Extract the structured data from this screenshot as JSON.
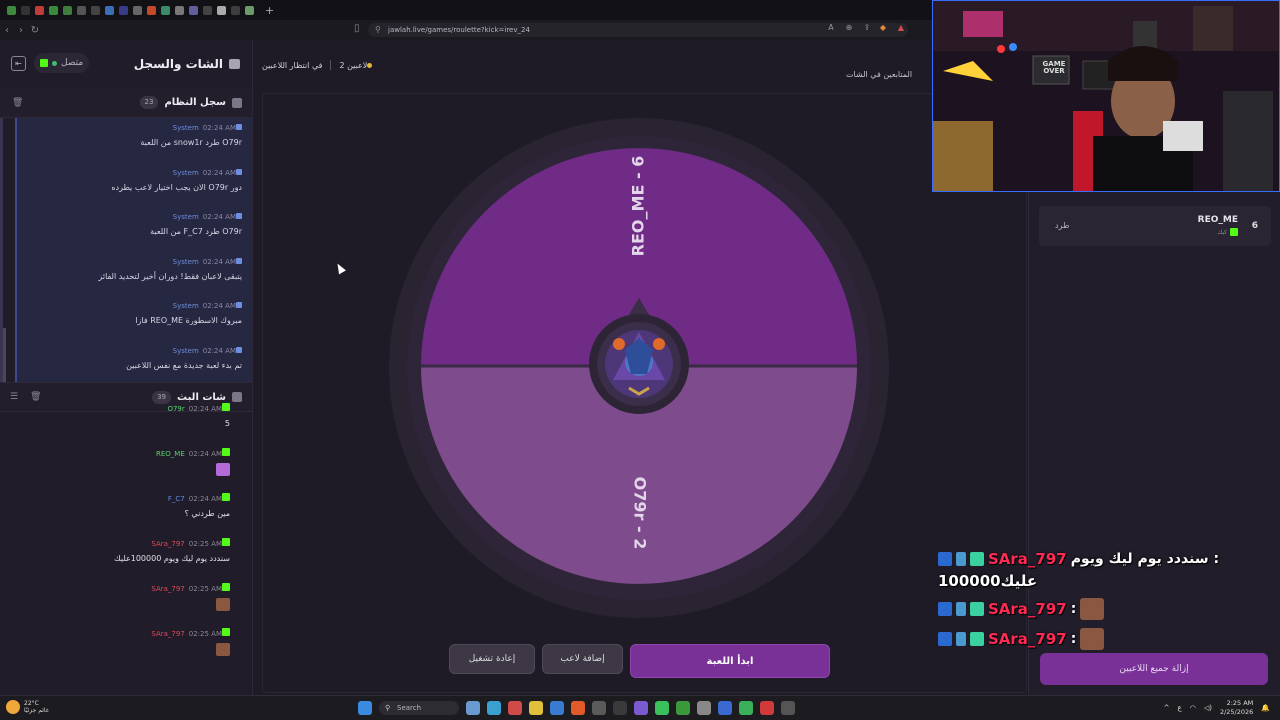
{
  "browser": {
    "url": "jawlah.live/games/roulette?kick=irev_24",
    "tab_colors": [
      "#3c8a3c",
      "#333",
      "#c23b3b",
      "#3b8a3b",
      "#3e7d3e",
      "#555",
      "#444",
      "#3b6fb5",
      "#3a3a8a",
      "#666",
      "#c24a2a",
      "#3b8a6a",
      "#777",
      "#5f5fa0",
      "#444",
      "#aaa",
      "#3d3d3d",
      "#6a9b6a"
    ],
    "new_tab": "+"
  },
  "sidebar": {
    "title": "الشات والسجل",
    "status": "متصل",
    "system_log": {
      "title": "سجل النظام",
      "count": "23",
      "items": [
        {
          "time": "02:24 AM",
          "author": "System",
          "text": "O79r طرد snow1r من اللعبة"
        },
        {
          "time": "02:24 AM",
          "author": "System",
          "text": "دور O79r الان يجب اختيار لاعب يطرده"
        },
        {
          "time": "02:24 AM",
          "author": "System",
          "text": "O79r طرد F_C7 من اللعبة"
        },
        {
          "time": "02:24 AM",
          "author": "System",
          "text": "يتبقى لاعبان فقط! دوران أخير لتحديد الفائز"
        },
        {
          "time": "02:24 AM",
          "author": "System",
          "text": "مبروك الاسطورة REO_ME فازا"
        },
        {
          "time": "02:24 AM",
          "author": "System",
          "text": "تم بدء لعبة جديدة مع نفس اللاعبين"
        }
      ]
    },
    "stream_chat": {
      "title": "شات البث",
      "count": "39",
      "items": [
        {
          "time": "02:24 AM",
          "user": "O79r",
          "color": "#53d36a",
          "text": "5",
          "emote": false
        },
        {
          "time": "02:24 AM",
          "user": "REO_ME",
          "color": "#53d36a",
          "text": "",
          "emote": true,
          "emote_color": "#b46ad8"
        },
        {
          "time": "02:24 AM",
          "user": "F_C7",
          "color": "#5a8ee8",
          "text": "مين طردني ؟",
          "emote": false
        },
        {
          "time": "02:25 AM",
          "user": "SAra_797",
          "color": "#e04a5a",
          "text": "سنددد يوم ليك ويوم 100000عليك",
          "emote": false
        },
        {
          "time": "02:25 AM",
          "user": "SAra_797",
          "color": "#e04a5a",
          "text": "",
          "emote": true,
          "emote_color": "#8a5840"
        },
        {
          "time": "02:25 AM",
          "user": "SAra_797",
          "color": "#e04a5a",
          "text": "",
          "emote": true,
          "emote_color": "#8a5840"
        }
      ]
    }
  },
  "main": {
    "players_count": "2 لاعبين",
    "waiting": "في انتظار اللاعبين",
    "followers_partial": "المتابعين في الشات",
    "wheel": {
      "segments": [
        {
          "label": "REO_ME - 6",
          "color": "#6f2b86"
        },
        {
          "label": "O79r - 2",
          "color": "#7e4b8c"
        }
      ]
    },
    "buttons": {
      "start": "ابدأ اللعبة",
      "add": "إضافة لاعب",
      "reset": "إعادة تشغيل"
    }
  },
  "right": {
    "player": {
      "number": "6",
      "name": "REO_ME",
      "platform": "كيك",
      "kick_label": "طرد"
    },
    "remove_all": "إزالة جميع اللاعبين"
  },
  "overlay_chat": [
    {
      "user": "SAra_797",
      "msg": "سنددد يوم ليك ويوم :",
      "cont": "100000عليك"
    },
    {
      "user": "SAra_797",
      "msg": ":",
      "face": true
    },
    {
      "user": "SAra_797",
      "msg": ":",
      "face": true
    }
  ],
  "webcam": {
    "sign_text": "GAME OVER"
  },
  "taskbar": {
    "weather_temp": "22°C",
    "weather_desc": "غائم جزئيًا",
    "search": "Search",
    "lang": "ع",
    "time": "2:25 AM",
    "date": "2/25/2026"
  }
}
